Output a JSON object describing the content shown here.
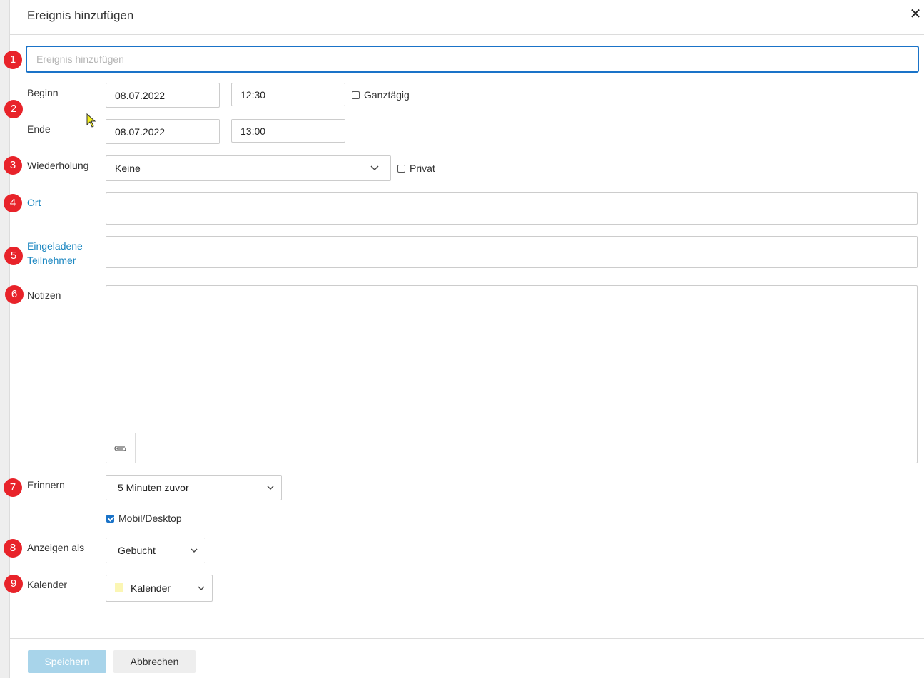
{
  "dialog": {
    "title": "Ereignis hinzufügen",
    "close_icon": "close-icon"
  },
  "markers": [
    "1",
    "2",
    "3",
    "4",
    "5",
    "6",
    "7",
    "8",
    "9"
  ],
  "event": {
    "title_placeholder": "Ereignis hinzufügen",
    "title_value": ""
  },
  "start": {
    "label": "Beginn",
    "date": "08.07.2022",
    "time": "12:30"
  },
  "end": {
    "label": "Ende",
    "date": "08.07.2022",
    "time": "13:00"
  },
  "all_day": {
    "label": "Ganztägig",
    "checked": false
  },
  "repeat": {
    "label": "Wiederholung",
    "value": "Keine"
  },
  "private": {
    "label": "Privat",
    "checked": false
  },
  "location": {
    "label": "Ort",
    "value": ""
  },
  "invitees": {
    "label_line1": "Eingeladene",
    "label_line2": "Teilnehmer",
    "value": ""
  },
  "notes": {
    "label": "Notizen",
    "value": "",
    "attach_icon": "paperclip-icon"
  },
  "reminder": {
    "label": "Erinnern",
    "value": "5 Minuten zuvor"
  },
  "mobile_desktop": {
    "label": "Mobil/Desktop",
    "checked": true
  },
  "show_as": {
    "label": "Anzeigen als",
    "value": "Gebucht"
  },
  "calendar": {
    "label": "Kalender",
    "value": "Kalender",
    "swatch_color": "#fbf6b4"
  },
  "buttons": {
    "save": "Speichern",
    "cancel": "Abbrechen"
  },
  "colors": {
    "accent": "#1a73c8",
    "link": "#1a86c0",
    "marker": "#e8232a",
    "save_disabled": "#a8d4ea"
  }
}
